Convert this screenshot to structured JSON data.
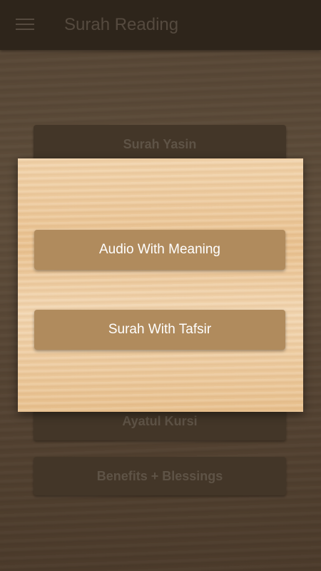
{
  "header": {
    "title": "Surah Reading",
    "menu_icon": "hamburger-menu-icon"
  },
  "main": {
    "buttons": [
      {
        "label": "Surah Yasin"
      },
      {
        "label": "Ayatul Kursi"
      },
      {
        "label": "Benefits + Blessings"
      }
    ]
  },
  "dialog": {
    "options": [
      {
        "label": "Audio With Meaning"
      },
      {
        "label": "Surah With Tafsir"
      }
    ]
  },
  "colors": {
    "appbar": "#44392a",
    "dialog_button": "#b08b5d",
    "dialog_text": "#ffffff"
  }
}
